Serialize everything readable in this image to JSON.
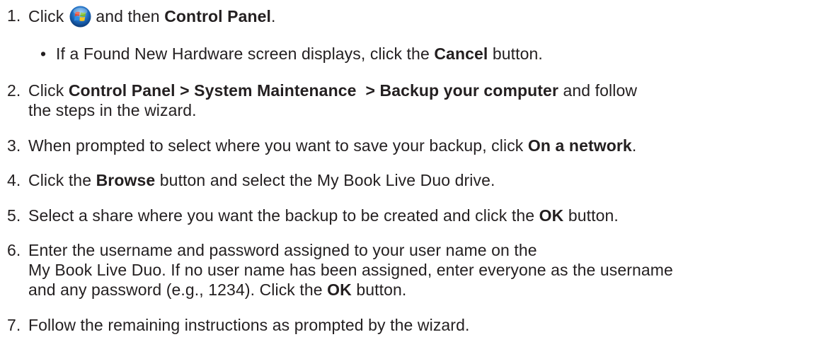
{
  "steps": [
    {
      "number": "1.",
      "before_icon": "Click",
      "icon": "windows-start-orb-icon",
      "after_icon": "and then",
      "bold": "Control Panel",
      "end": "."
    },
    {
      "bullet": "•",
      "before": "If a Found New Hardware screen displays, click the",
      "bold": "Cancel",
      "after": "button."
    },
    {
      "number": "2.",
      "before": "Click",
      "bold": "Control Panel > System Maintenance  > Backup your computer",
      "after": "and follow",
      "line2": "the steps in the wizard."
    },
    {
      "number": "3.",
      "before": "When prompted to select where you want to save your backup, click",
      "bold": "On a network",
      "after": "."
    },
    {
      "number": "4.",
      "before": "Click the",
      "bold": "Browse",
      "after": "button and select the My Book Live Duo drive."
    },
    {
      "number": "5.",
      "before": "Select a share where you want the backup to be created and click the",
      "bold": "OK",
      "after": "button."
    },
    {
      "number": "6.",
      "line1": "Enter the username and password assigned to your user name on the",
      "line2": "My Book Live Duo. If no user name has been assigned, enter everyone as the username",
      "line3_before": "and any password (e.g., 1234). Click the",
      "line3_bold": "OK",
      "line3_after": "button."
    },
    {
      "number": "7.",
      "text": "Follow the remaining instructions as prompted by the wizard."
    }
  ],
  "colors": {
    "text": "#231f20",
    "orb_blue": "#1f6fc4",
    "flag_red": "#e8452c",
    "flag_green": "#7cbb2a",
    "flag_blue": "#2f8fe6",
    "flag_yellow": "#f7c520"
  }
}
